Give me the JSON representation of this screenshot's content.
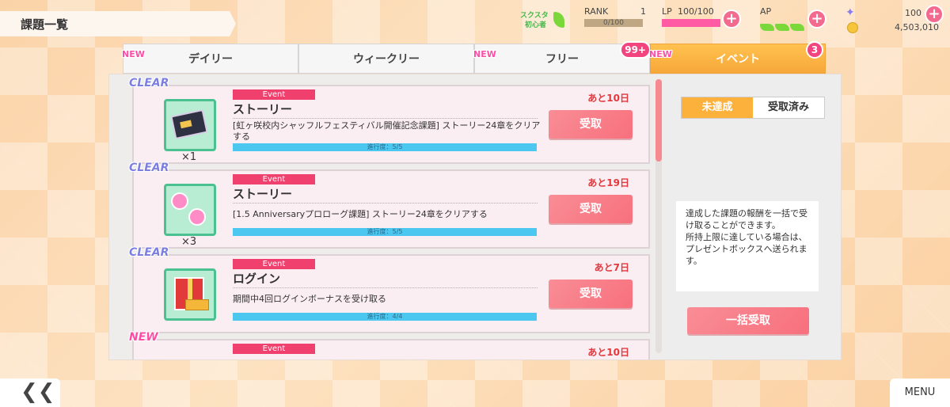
{
  "header": {
    "title": "課題一覧",
    "sukusuta": {
      "line1": "スクスタ",
      "line2": "初心者"
    },
    "rank": {
      "label": "RANK",
      "value": "1",
      "exp": "0/100"
    },
    "lp": {
      "label": "LP",
      "value": "100/100"
    },
    "ap": {
      "label": "AP"
    },
    "currency": {
      "gems": "100",
      "gold": "4,503,010"
    }
  },
  "tabs": [
    {
      "label": "デイリー",
      "new": "NEW",
      "badge": ""
    },
    {
      "label": "ウィークリー",
      "new": "",
      "badge": ""
    },
    {
      "label": "フリー",
      "new": "NEW",
      "badge": "99+"
    },
    {
      "label": "イベント",
      "new": "NEW",
      "badge": "3"
    }
  ],
  "missions": [
    {
      "status": "CLEAR",
      "tag": "Event",
      "title": "ストーリー",
      "description": "[虹ヶ咲校内シャッフルフェスティバル開催記念課題] ストーリー24章をクリアする",
      "progress_label": "進行度：5/5",
      "progress": 1.0,
      "deadline": "あと10日",
      "button": "受取",
      "qty": "×1",
      "reward_icon": "ticket-icon"
    },
    {
      "status": "CLEAR",
      "tag": "Event",
      "title": "ストーリー",
      "description": "[1.5 Anniversaryプロローグ課題] ストーリー24章をクリアする",
      "progress_label": "進行度：5/5",
      "progress": 1.0,
      "deadline": "あと19日",
      "button": "受取",
      "qty": "×3",
      "reward_icon": "candy-icon"
    },
    {
      "status": "CLEAR",
      "tag": "Event",
      "title": "ログイン",
      "description": "期間中4回ログインボーナスを受け取る",
      "progress_label": "進行度：4/4",
      "progress": 1.0,
      "deadline": "あと7日",
      "button": "受取",
      "qty": "",
      "reward_icon": "gift-icon"
    },
    {
      "status": "NEW",
      "tag": "Event",
      "deadline": "あと10日"
    }
  ],
  "side": {
    "filter_unachieved": "未達成",
    "filter_received": "受取済み",
    "info": "達成した課題の報酬を一括で受け取ることができます。\n所持上限に達している場合は、プレゼントボックスへ送られます。",
    "bulk_button": "一括受取"
  },
  "footer": {
    "back": "❮❮",
    "menu": "MENU"
  },
  "colors": {
    "accent": "#f7707d",
    "tab_active": "#f7a73a",
    "progress": "#4cc7ef",
    "clear": "#7d7fe0",
    "new": "#ff4da6"
  }
}
